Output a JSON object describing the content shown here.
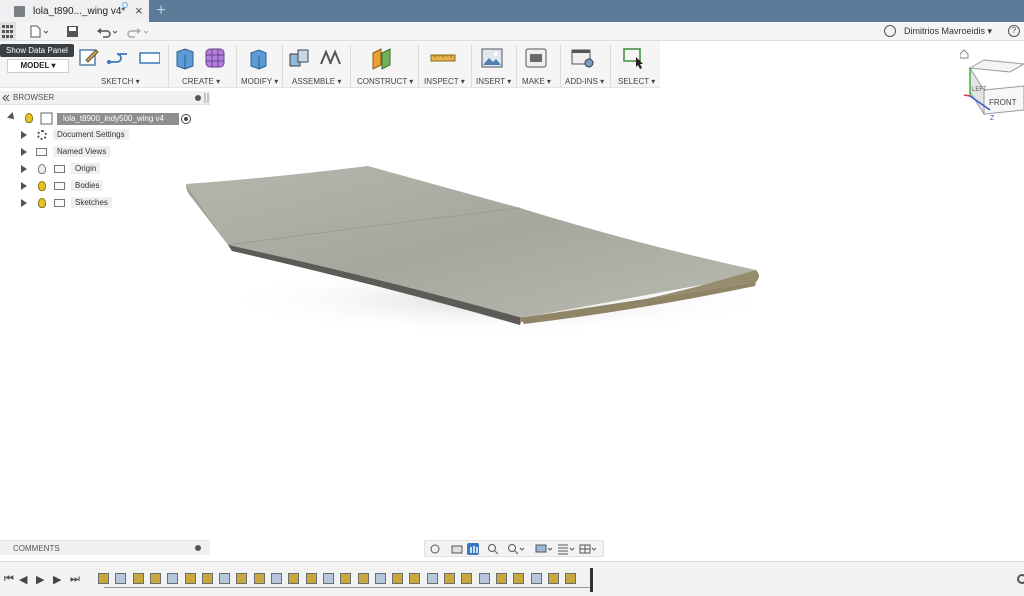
{
  "window": {
    "doc_tab_title": "lola_t890..._wing v4*",
    "close_glyph": "×",
    "new_tab_glyph": "+"
  },
  "quick_access": {
    "user_name": "Dimitrios Mavroeidis ▾",
    "icons": [
      "apps-grid-icon",
      "file-menu-icon",
      "save-icon",
      "undo-icon",
      "redo-icon",
      "job-status-icon",
      "help-icon"
    ]
  },
  "tooltip": "Show Data Panel",
  "workspace": "MODEL ▾",
  "toolbar_groups": [
    {
      "label": "SKETCH ▾"
    },
    {
      "label": "CREATE ▾"
    },
    {
      "label": "MODIFY ▾"
    },
    {
      "label": "ASSEMBLE ▾"
    },
    {
      "label": "CONSTRUCT ▾"
    },
    {
      "label": "INSPECT ▾"
    },
    {
      "label": "INSERT ▾"
    },
    {
      "label": "MAKE ▾"
    },
    {
      "label": "ADD-INS ▾"
    },
    {
      "label": "SELECT ▾"
    }
  ],
  "browser": {
    "title": "BROWSER",
    "root": "lola_t8900_indy500_wing v4",
    "items": [
      {
        "label": "Document Settings"
      },
      {
        "label": "Named Views"
      },
      {
        "label": "Origin"
      },
      {
        "label": "Bodies"
      },
      {
        "label": "Sketches"
      }
    ]
  },
  "comments": {
    "title": "COMMENTS"
  },
  "viewcube": {
    "face_front": "FRONT",
    "face_left": "LEFT",
    "axis_z": "Z"
  },
  "colors": {
    "titlebar": "#5c7b98",
    "model_surface": "#a9aaa0",
    "model_edge": "#8f8466",
    "timeline_feature": "#c8a83c"
  }
}
